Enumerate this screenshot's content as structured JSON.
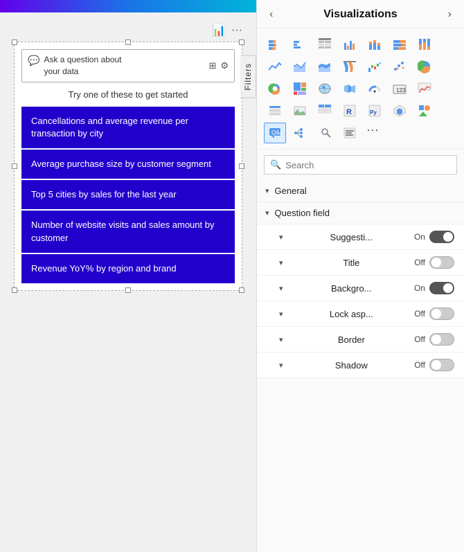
{
  "left": {
    "toolbar": {
      "chart_icon": "📊",
      "more_icon": "···"
    },
    "qa_input": {
      "placeholder_line1": "Ask a question about",
      "placeholder_line2": "your data"
    },
    "try_text": "Try one of these to get started",
    "suggestions": [
      "Cancellations and average revenue per transaction by city",
      "Average purchase size by customer segment",
      "Top 5 cities by sales for the last year",
      "Number of website visits and sales amount by customer",
      "Revenue YoY% by region and brand"
    ],
    "filters_tab": "Filters"
  },
  "right": {
    "header": {
      "title": "Visualizations",
      "prev_arrow": "‹",
      "next_arrow": "›"
    },
    "search": {
      "placeholder": "Search"
    },
    "sections": [
      {
        "label": "General"
      },
      {
        "label": "Question field"
      }
    ],
    "toggles": [
      {
        "label": "Suggesti...",
        "state": "On",
        "on": true
      },
      {
        "label": "Title",
        "state": "Off",
        "on": false
      },
      {
        "label": "Backgro...",
        "state": "On",
        "on": true
      },
      {
        "label": "Lock asp...",
        "state": "Off",
        "on": false
      },
      {
        "label": "Border",
        "state": "Off",
        "on": false
      },
      {
        "label": "Shadow",
        "state": "Off",
        "on": false
      }
    ],
    "icons": [
      {
        "name": "stacked-bar",
        "char": "▦"
      },
      {
        "name": "clustered-bar",
        "char": "▤"
      },
      {
        "name": "table-icon",
        "char": "⊞"
      },
      {
        "name": "clustered-column",
        "char": "📊"
      },
      {
        "name": "stacked-column",
        "char": "⬛"
      },
      {
        "name": "100pct-bar",
        "char": "▧"
      },
      {
        "name": "100pct-column",
        "char": "▨"
      },
      {
        "name": "line-chart",
        "char": "📈"
      },
      {
        "name": "area-chart",
        "char": "⛰"
      },
      {
        "name": "stacked-area",
        "char": "🏔"
      },
      {
        "name": "ribbon-chart",
        "char": "🎀"
      },
      {
        "name": "waterfall",
        "char": "💧"
      },
      {
        "name": "scatter",
        "char": "⁘"
      },
      {
        "name": "pie-chart",
        "char": "🥧"
      },
      {
        "name": "donut",
        "char": "⭕"
      },
      {
        "name": "treemap",
        "char": "⬜"
      },
      {
        "name": "map-icon",
        "char": "🗺"
      },
      {
        "name": "filled-map",
        "char": "🌍"
      },
      {
        "name": "gauge",
        "char": "⏱"
      },
      {
        "name": "card-icon",
        "char": "123"
      },
      {
        "name": "kpi-icon",
        "char": "📉"
      },
      {
        "name": "slicer-icon",
        "char": "🔲"
      },
      {
        "name": "image-icon",
        "char": "🖼"
      },
      {
        "name": "table2",
        "char": "⊟"
      },
      {
        "name": "matrix",
        "char": "⊞"
      },
      {
        "name": "r-visual",
        "char": "R"
      },
      {
        "name": "python",
        "char": "Py"
      },
      {
        "name": "custom-viz",
        "char": "⬡"
      },
      {
        "name": "shape",
        "char": "⬟"
      },
      {
        "name": "qa-icon-viz",
        "char": "💬"
      },
      {
        "name": "decomp-tree",
        "char": "🌲"
      },
      {
        "name": "key-influencers",
        "char": "🔑"
      },
      {
        "name": "smart-narrative",
        "char": "◧"
      },
      {
        "name": "more-dots",
        "char": "···"
      }
    ]
  }
}
